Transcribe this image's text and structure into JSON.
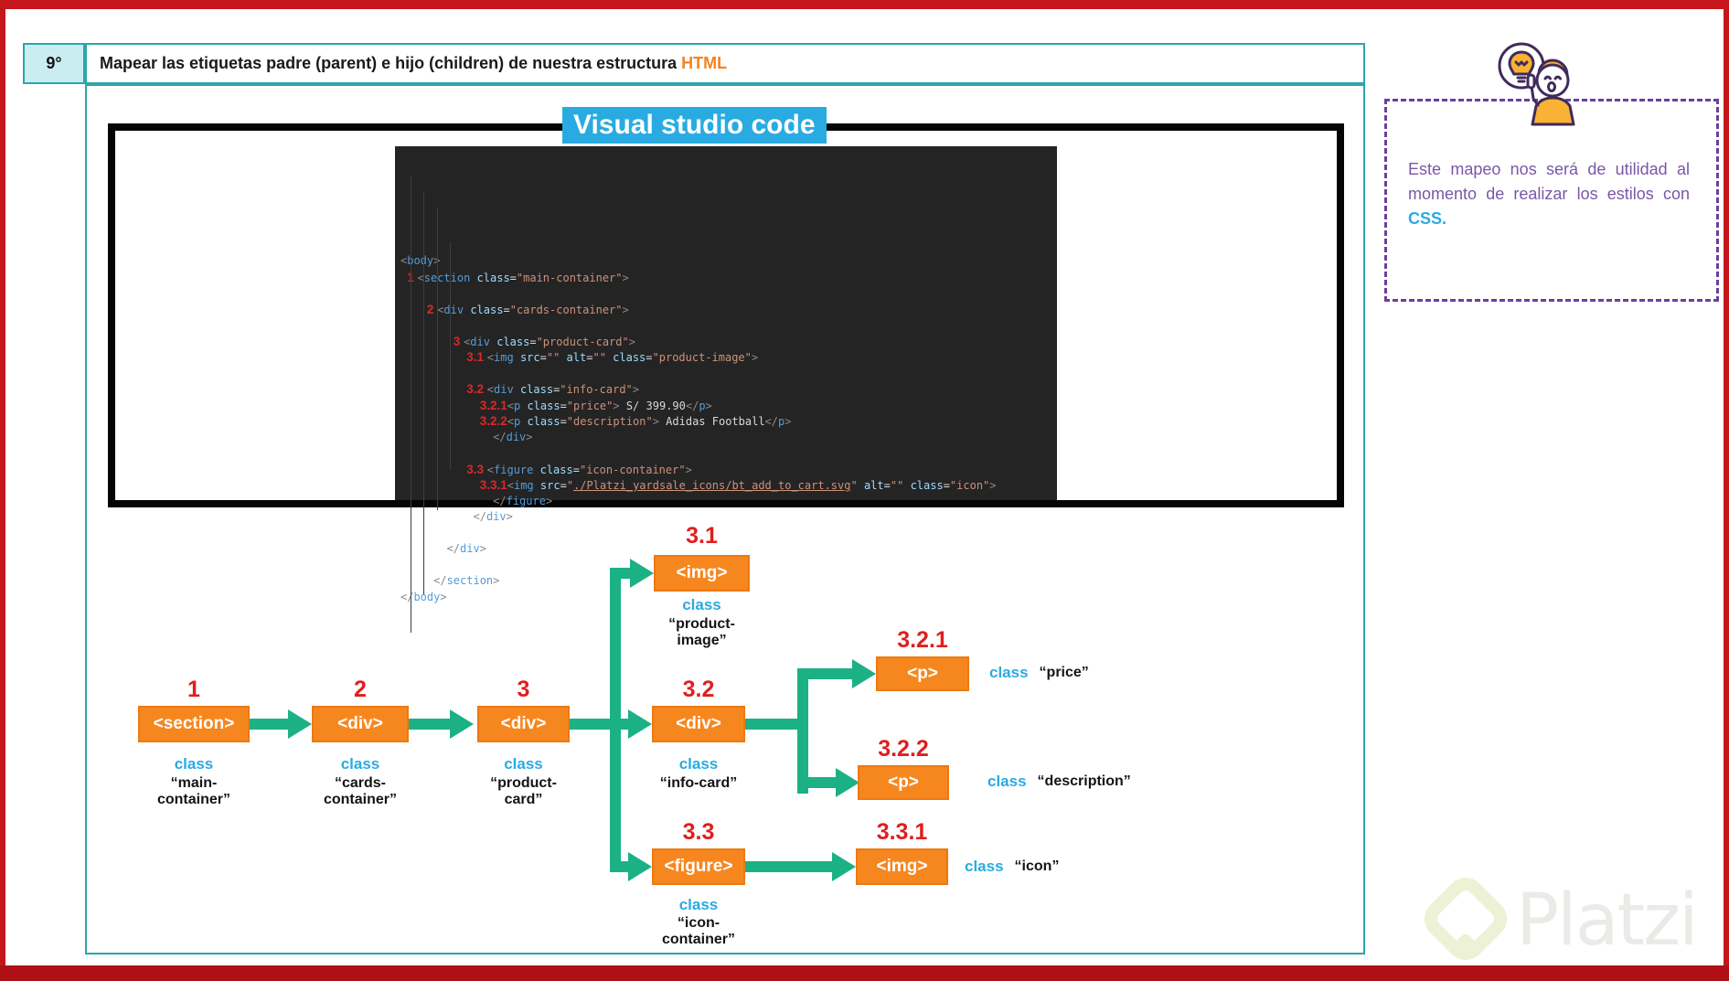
{
  "header": {
    "lesson_number": "9°",
    "title_prefix": "Mapear las etiquetas padre (parent) e hijo (children) de nuestra estructura",
    "title_highlight": "HTML"
  },
  "vscode": {
    "window_title": "Visual studio code",
    "code_lines": [
      [
        [
          "p",
          "<"
        ],
        [
          "t",
          "body"
        ],
        [
          "p",
          ">"
        ]
      ],
      [
        [
          "w",
          " "
        ],
        [
          "n",
          "1 "
        ],
        [
          "p",
          "<"
        ],
        [
          "t",
          "section"
        ],
        [
          "w",
          " "
        ],
        [
          "a",
          "class"
        ],
        [
          "w",
          "="
        ],
        [
          "s",
          "\"main-container\""
        ],
        [
          "p",
          ">"
        ]
      ],
      [],
      [
        [
          "w",
          "    "
        ],
        [
          "n",
          "2 "
        ],
        [
          "p",
          "<"
        ],
        [
          "t",
          "div"
        ],
        [
          "w",
          " "
        ],
        [
          "a",
          "class"
        ],
        [
          "w",
          "="
        ],
        [
          "s",
          "\"cards-container\""
        ],
        [
          "p",
          ">"
        ]
      ],
      [],
      [
        [
          "w",
          "        "
        ],
        [
          "n",
          "3 "
        ],
        [
          "p",
          "<"
        ],
        [
          "t",
          "div"
        ],
        [
          "w",
          " "
        ],
        [
          "a",
          "class"
        ],
        [
          "w",
          "="
        ],
        [
          "s",
          "\"product-card\""
        ],
        [
          "p",
          ">"
        ]
      ],
      [
        [
          "w",
          "          "
        ],
        [
          "n",
          "3.1 "
        ],
        [
          "p",
          "<"
        ],
        [
          "t",
          "img"
        ],
        [
          "w",
          " "
        ],
        [
          "a",
          "src"
        ],
        [
          "w",
          "="
        ],
        [
          "s",
          "\"\""
        ],
        [
          "w",
          " "
        ],
        [
          "a",
          "alt"
        ],
        [
          "w",
          "="
        ],
        [
          "s",
          "\"\""
        ],
        [
          "w",
          " "
        ],
        [
          "a",
          "class"
        ],
        [
          "w",
          "="
        ],
        [
          "s",
          "\"product-image\""
        ],
        [
          "p",
          ">"
        ]
      ],
      [],
      [
        [
          "w",
          "          "
        ],
        [
          "n",
          "3.2 "
        ],
        [
          "p",
          "<"
        ],
        [
          "t",
          "div"
        ],
        [
          "w",
          " "
        ],
        [
          "a",
          "class"
        ],
        [
          "w",
          "="
        ],
        [
          "s",
          "\"info-card\""
        ],
        [
          "p",
          ">"
        ]
      ],
      [
        [
          "w",
          "            "
        ],
        [
          "n",
          "3.2.1"
        ],
        [
          "p",
          "<"
        ],
        [
          "t",
          "p"
        ],
        [
          "w",
          " "
        ],
        [
          "a",
          "class"
        ],
        [
          "w",
          "="
        ],
        [
          "s",
          "\"price\""
        ],
        [
          "p",
          ">"
        ],
        [
          "w",
          " S/ 399.90"
        ],
        [
          "p",
          "</"
        ],
        [
          "t",
          "p"
        ],
        [
          "p",
          ">"
        ]
      ],
      [
        [
          "w",
          "            "
        ],
        [
          "n",
          "3.2.2"
        ],
        [
          "p",
          "<"
        ],
        [
          "t",
          "p"
        ],
        [
          "w",
          " "
        ],
        [
          "a",
          "class"
        ],
        [
          "w",
          "="
        ],
        [
          "s",
          "\"description\""
        ],
        [
          "p",
          ">"
        ],
        [
          "w",
          " Adidas Football"
        ],
        [
          "p",
          "</"
        ],
        [
          "t",
          "p"
        ],
        [
          "p",
          ">"
        ]
      ],
      [
        [
          "w",
          "              "
        ],
        [
          "p",
          "</"
        ],
        [
          "t",
          "div"
        ],
        [
          "p",
          ">"
        ]
      ],
      [],
      [
        [
          "w",
          "          "
        ],
        [
          "n",
          "3.3 "
        ],
        [
          "p",
          "<"
        ],
        [
          "t",
          "figure"
        ],
        [
          "w",
          " "
        ],
        [
          "a",
          "class"
        ],
        [
          "w",
          "="
        ],
        [
          "s",
          "\"icon-container\""
        ],
        [
          "p",
          ">"
        ]
      ],
      [
        [
          "w",
          "            "
        ],
        [
          "n",
          "3.3.1"
        ],
        [
          "p",
          "<"
        ],
        [
          "t",
          "img"
        ],
        [
          "w",
          " "
        ],
        [
          "a",
          "src"
        ],
        [
          "w",
          "="
        ],
        [
          "s",
          "\""
        ],
        [
          "l",
          "./Platzi_yardsale_icons/bt_add_to_cart.svg"
        ],
        [
          "s",
          "\""
        ],
        [
          "w",
          " "
        ],
        [
          "a",
          "alt"
        ],
        [
          "w",
          "="
        ],
        [
          "s",
          "\"\""
        ],
        [
          "w",
          " "
        ],
        [
          "a",
          "class"
        ],
        [
          "w",
          "="
        ],
        [
          "s",
          "\"icon\""
        ],
        [
          "p",
          ">"
        ]
      ],
      [
        [
          "w",
          "              "
        ],
        [
          "p",
          "</"
        ],
        [
          "t",
          "figure"
        ],
        [
          "p",
          ">"
        ]
      ],
      [
        [
          "w",
          "           "
        ],
        [
          "p",
          "</"
        ],
        [
          "t",
          "div"
        ],
        [
          "p",
          ">"
        ]
      ],
      [],
      [
        [
          "w",
          "       "
        ],
        [
          "p",
          "</"
        ],
        [
          "t",
          "div"
        ],
        [
          "p",
          ">"
        ]
      ],
      [],
      [
        [
          "w",
          "     "
        ],
        [
          "p",
          "</"
        ],
        [
          "t",
          "section"
        ],
        [
          "p",
          ">"
        ]
      ],
      [
        [
          "p",
          "</"
        ],
        [
          "t",
          "body"
        ],
        [
          "p",
          ">"
        ]
      ]
    ]
  },
  "note": {
    "text_before": "Este mapeo nos será de utilidad al momento de realizar los estilos con ",
    "highlight": "CSS."
  },
  "diagram": {
    "nodes": [
      {
        "num": "1",
        "tag": "<section>",
        "class_label": "class",
        "line1": "“main-",
        "line2": "container”"
      },
      {
        "num": "2",
        "tag": "<div>",
        "class_label": "class",
        "line1": "“cards-",
        "line2": "container”"
      },
      {
        "num": "3",
        "tag": "<div>",
        "class_label": "class",
        "line1": "“product-",
        "line2": "card”"
      },
      {
        "num": "3.1",
        "tag": "<img>",
        "class_label": "class",
        "line1": "“product-",
        "line2": "image”"
      },
      {
        "num": "3.2",
        "tag": "<div>",
        "class_label": "class",
        "line1": "“info-card”",
        "line2": ""
      },
      {
        "num": "3.2.1",
        "tag": "<p>",
        "class_label": "class",
        "side_value": "“price”"
      },
      {
        "num": "3.2.2",
        "tag": "<p>",
        "class_label": "class",
        "side_value": "“description”"
      },
      {
        "num": "3.3",
        "tag": "<figure>",
        "class_label": "class",
        "line1": "“icon-",
        "line2": "container”"
      },
      {
        "num": "3.3.1",
        "tag": "<img>",
        "class_label": "class",
        "side_value": "“icon”"
      }
    ]
  },
  "watermark": {
    "brand": "Platzi"
  },
  "colors": {
    "accent_orange": "#F6871F",
    "arrow_green": "#1BB185",
    "number_red": "#E01E1E",
    "class_cyan": "#29ABE2",
    "note_purple": "#6B3FA0",
    "frame_teal": "#2BA6AB",
    "frame_red": "#C5171B",
    "bottom_red": "#AE1015",
    "code_background": "#242425"
  }
}
